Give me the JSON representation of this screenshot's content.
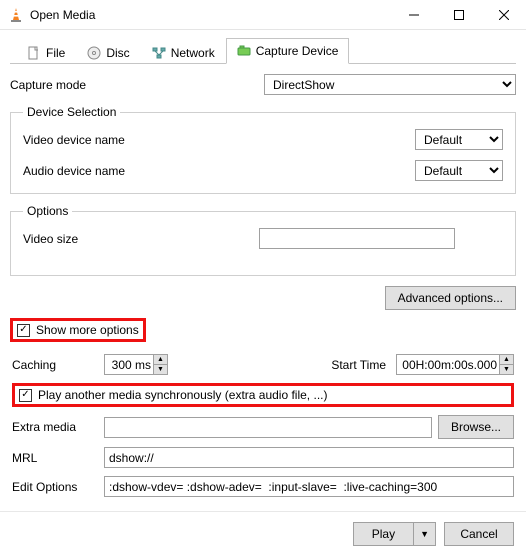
{
  "window": {
    "title": "Open Media"
  },
  "tabs": {
    "file": "File",
    "disc": "Disc",
    "network": "Network",
    "capture": "Capture Device"
  },
  "capture": {
    "capture_mode_label": "Capture mode",
    "capture_mode_value": "DirectShow",
    "device_selection_legend": "Device Selection",
    "video_device_label": "Video device name",
    "video_device_value": "Default",
    "audio_device_label": "Audio device name",
    "audio_device_value": "Default",
    "options_legend": "Options",
    "video_size_label": "Video size",
    "video_size_value": "",
    "advanced_options_btn": "Advanced options..."
  },
  "more": {
    "show_more_label": "Show more options",
    "caching_label": "Caching",
    "caching_value": "300 ms",
    "start_time_label": "Start Time",
    "start_time_value": "00H:00m:00s.000",
    "play_sync_label": "Play another media synchronously (extra audio file, ...)",
    "extra_media_label": "Extra media",
    "extra_media_value": "",
    "browse_btn": "Browse...",
    "mrl_label": "MRL",
    "mrl_value": "dshow://",
    "edit_options_label": "Edit Options",
    "edit_options_value": ":dshow-vdev= :dshow-adev=  :input-slave=  :live-caching=300"
  },
  "footer": {
    "play": "Play",
    "cancel": "Cancel"
  }
}
